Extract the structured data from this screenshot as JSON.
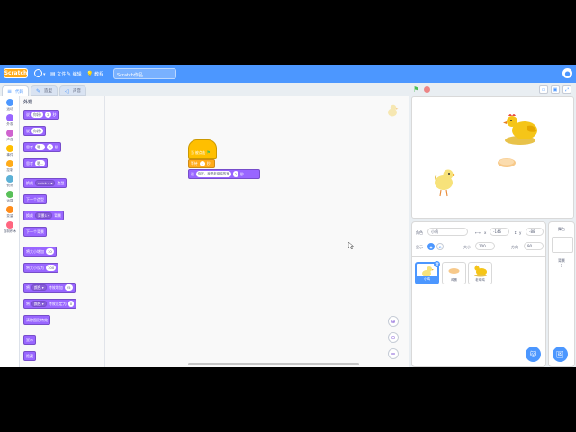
{
  "menubar": {
    "logo": "Scratch",
    "file": "文件",
    "edit": "编辑",
    "tutorials": "教程",
    "project_title": "Scratch作品"
  },
  "tabs": {
    "code": "代码",
    "costumes": "造型",
    "sounds": "声音"
  },
  "categories": [
    {
      "label": "运动",
      "color": "#4c97ff"
    },
    {
      "label": "外观",
      "color": "#9966ff"
    },
    {
      "label": "声音",
      "color": "#cf63cf"
    },
    {
      "label": "事件",
      "color": "#ffbf00"
    },
    {
      "label": "控制",
      "color": "#ffab19"
    },
    {
      "label": "侦测",
      "color": "#5cb1d6"
    },
    {
      "label": "运算",
      "color": "#59c059"
    },
    {
      "label": "变量",
      "color": "#ff8c1a"
    },
    {
      "label": "自制积木",
      "color": "#ff6680"
    }
  ],
  "palette": {
    "title": "外观",
    "blocks": [
      {
        "parts": [
          [
            "t",
            "说"
          ],
          [
            "in",
            "你好!"
          ],
          [
            "t",
            ""
          ],
          [
            "in",
            "2"
          ],
          [
            "t",
            "秒"
          ]
        ]
      },
      {
        "parts": [
          [
            "t",
            "说"
          ],
          [
            "in",
            "你好!"
          ]
        ]
      },
      {
        "parts": [
          [
            "t",
            "思考"
          ],
          [
            "in",
            "嗯..."
          ],
          [
            "t",
            ""
          ],
          [
            "in",
            "2"
          ],
          [
            "t",
            "秒"
          ]
        ]
      },
      {
        "parts": [
          [
            "t",
            "思考"
          ],
          [
            "in",
            "嗯..."
          ]
        ]
      },
      {
        "parts": [
          [
            "t",
            "换成"
          ],
          [
            "dd",
            "chick-c ▾"
          ],
          [
            "t",
            "造型"
          ]
        ]
      },
      {
        "parts": [
          [
            "t",
            "下一个造型"
          ]
        ]
      },
      {
        "parts": [
          [
            "t",
            "换成"
          ],
          [
            "dd",
            "背景1 ▾"
          ],
          [
            "t",
            "背景"
          ]
        ]
      },
      {
        "parts": [
          [
            "t",
            "下一个背景"
          ]
        ]
      },
      {
        "parts": [
          [
            "t",
            "将大小增加"
          ],
          [
            "in",
            "10"
          ]
        ]
      },
      {
        "parts": [
          [
            "t",
            "将大小设为"
          ],
          [
            "in",
            "100"
          ]
        ]
      },
      {
        "parts": [
          [
            "t",
            "将"
          ],
          [
            "dd",
            "颜色 ▾"
          ],
          [
            "t",
            "特效增加"
          ],
          [
            "in",
            "25"
          ]
        ]
      },
      {
        "parts": [
          [
            "t",
            "将"
          ],
          [
            "dd",
            "颜色 ▾"
          ],
          [
            "t",
            "特效设定为"
          ],
          [
            "in",
            "0"
          ]
        ]
      },
      {
        "parts": [
          [
            "t",
            "清除图形特效"
          ]
        ]
      },
      {
        "parts": [
          [
            "t",
            "显示"
          ]
        ]
      },
      {
        "parts": [
          [
            "t",
            "隐藏"
          ]
        ]
      }
    ]
  },
  "script": {
    "hat_label": "当 被点击",
    "wait_label": "等待",
    "wait_value": "1",
    "wait_unit": "秒",
    "say_label": "说",
    "say_text": "你好，我是老母鸡的宝",
    "say_secs": "2",
    "say_unit": "秒"
  },
  "sprite_info": {
    "sprite_label": "角色",
    "sprite_name": "小鸡",
    "x_label": "x",
    "x_value": "-146",
    "y_label": "y",
    "y_value": "-88",
    "show_label": "显示",
    "size_label": "大小",
    "size_value": "100",
    "direction_label": "方向",
    "direction_value": "90"
  },
  "sprites": [
    {
      "name": "小鸡"
    },
    {
      "name": "鸡蛋"
    },
    {
      "name": "老母鸡"
    }
  ],
  "stage_pane": {
    "label": "舞台",
    "backdrops_label": "背景",
    "backdrops_count": "1"
  }
}
